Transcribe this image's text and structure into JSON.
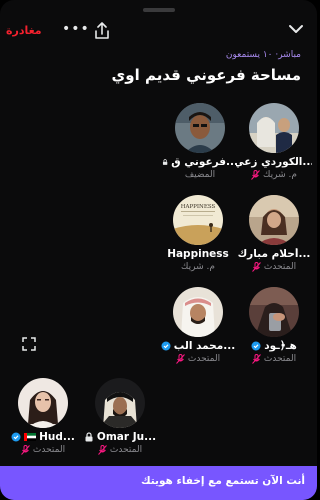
{
  "header": {
    "leave_label": "مغادرة",
    "more_icon": "more-horizontal-icon",
    "share_icon": "share-icon",
    "collapse_icon": "chevron-down-icon"
  },
  "space": {
    "status": "مباشر· ١٠ يستمعون",
    "title": "مساحة فرعوني قديم اوي"
  },
  "participants": [
    {
      "name": "فرعوني ق...",
      "role": "المضيف",
      "lock": true,
      "verified": false,
      "mic_muted": false
    },
    {
      "name": "الكوردي زعي...",
      "role": "م. شريك",
      "lock": false,
      "verified": false,
      "mic_muted": true
    },
    {
      "name": "Happiness",
      "role": "م. شريك",
      "lock": false,
      "verified": false,
      "mic_muted": false
    },
    {
      "name": "أحلام مبارك...",
      "role": "المتحدث",
      "lock": false,
      "verified": false,
      "mic_muted": true
    },
    {
      "name": "محمد الب...",
      "role": "المتحدث",
      "lock": false,
      "verified": true,
      "mic_muted": true
    },
    {
      "name": "هـ﴿ـود",
      "role": "المتحدث",
      "lock": false,
      "verified": true,
      "mic_muted": true
    },
    {
      "name": "Hud...",
      "role": "المتحدث",
      "lock": false,
      "verified": true,
      "flag": true,
      "mic_muted": true
    },
    {
      "name": "Omar Ju...",
      "role": "المتحدث",
      "lock": true,
      "verified": false,
      "mic_muted": true
    }
  ],
  "happiness_cover_text": "HAPPINESS",
  "fullscreen_icon": "fullscreen-icon",
  "banner": {
    "text": "أنت الآن تستمع مع إخفاء هويتك"
  },
  "colors": {
    "accent": "#7856ff",
    "leave": "#f4212e",
    "status": "#a98bf0",
    "muted_mic": "#f91880",
    "verified": "#1d9bf0"
  }
}
